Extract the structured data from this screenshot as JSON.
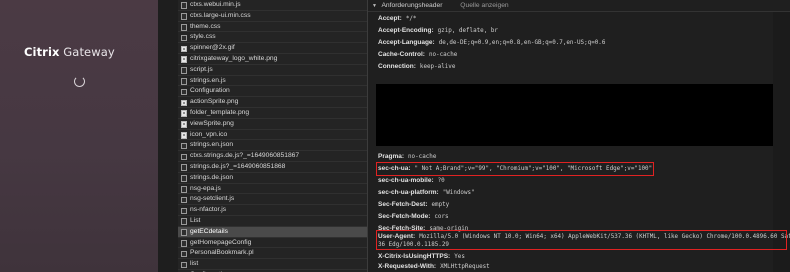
{
  "login": {
    "brand": "Citrix",
    "product": "Gateway"
  },
  "files": [
    {
      "name": "ctxs.webui.min.js",
      "icon": "script-file-icon"
    },
    {
      "name": "ctxs.large-ui.min.css",
      "icon": "css-file-icon"
    },
    {
      "name": "theme.css",
      "icon": "css-file-icon"
    },
    {
      "name": "style.css",
      "icon": "css-file-icon"
    },
    {
      "name": "spinner@2x.gif",
      "icon": "image-file-icon"
    },
    {
      "name": "citrixgateway_logo_white.png",
      "icon": "image-file-icon"
    },
    {
      "name": "script.js",
      "icon": "script-file-icon"
    },
    {
      "name": "strings.en.js",
      "icon": "script-file-icon"
    },
    {
      "name": "Configuration",
      "icon": "document-icon"
    },
    {
      "name": "actionSprite.png",
      "icon": "image-file-icon"
    },
    {
      "name": "folder_template.png",
      "icon": "image-file-icon"
    },
    {
      "name": "viewSprite.png",
      "icon": "image-file-icon"
    },
    {
      "name": "icon_vpn.ico",
      "icon": "image-file-icon"
    },
    {
      "name": "strings.en.json",
      "icon": "document-icon"
    },
    {
      "name": "ctxs.strings.de.js?_=1649060851867",
      "icon": "script-file-icon"
    },
    {
      "name": "strings.de.js?_=1649060851868",
      "icon": "script-file-icon"
    },
    {
      "name": "strings.de.json",
      "icon": "document-icon"
    },
    {
      "name": "nsg-epa.js",
      "icon": "script-file-icon"
    },
    {
      "name": "nsg-setclient.js",
      "icon": "script-file-icon"
    },
    {
      "name": "ns-nfactor.js",
      "icon": "script-file-icon"
    },
    {
      "name": "List",
      "icon": "document-icon"
    },
    {
      "name": "getECdetails",
      "icon": "document-icon",
      "selected": true
    },
    {
      "name": "getHomepageConfig",
      "icon": "document-icon"
    },
    {
      "name": "PersonalBookmark.pl",
      "icon": "document-icon"
    },
    {
      "name": "list",
      "icon": "document-icon"
    },
    {
      "name": "Configuration",
      "icon": "document-icon"
    }
  ],
  "panel": {
    "section_title": "Anforderungsheader",
    "view_source": "Quelle anzeigen"
  },
  "headers": [
    {
      "name": "Accept:",
      "value": "*/*"
    },
    {
      "name": "Accept-Encoding:",
      "value": "gzip, deflate, br"
    },
    {
      "name": "Accept-Language:",
      "value": "de,de-DE;q=0.9,en;q=0.8,en-GB;q=0.7,en-US;q=0.6"
    },
    {
      "name": "Cache-Control:",
      "value": "no-cache"
    },
    {
      "name": "Connection:",
      "value": "keep-alive"
    },
    {
      "name": "Pragma:",
      "value": "no-cache"
    },
    {
      "name": "sec-ch-ua:",
      "value": "\" Not A;Brand\";v=\"99\", \"Chromium\";v=\"100\", \"Microsoft Edge\";v=\"100\""
    },
    {
      "name": "sec-ch-ua-mobile:",
      "value": "?0"
    },
    {
      "name": "sec-ch-ua-platform:",
      "value": "\"Windows\""
    },
    {
      "name": "Sec-Fetch-Dest:",
      "value": "empty"
    },
    {
      "name": "Sec-Fetch-Mode:",
      "value": "cors"
    },
    {
      "name": "Sec-Fetch-Site:",
      "value": "same-origin"
    },
    {
      "name": "User-Agent:",
      "value": "Mozilla/5.0 (Windows NT 10.0; Win64; x64) AppleWebKit/537.36 (KHTML, like Gecko) Chrome/100.0.4896.60 Safari/537."
    },
    {
      "name": "",
      "value": "36 Edg/100.0.1185.29"
    },
    {
      "name": "X-Citrix-IsUsingHTTPS:",
      "value": "Yes"
    },
    {
      "name": "X-Requested-With:",
      "value": "XMLHttpRequest"
    }
  ]
}
